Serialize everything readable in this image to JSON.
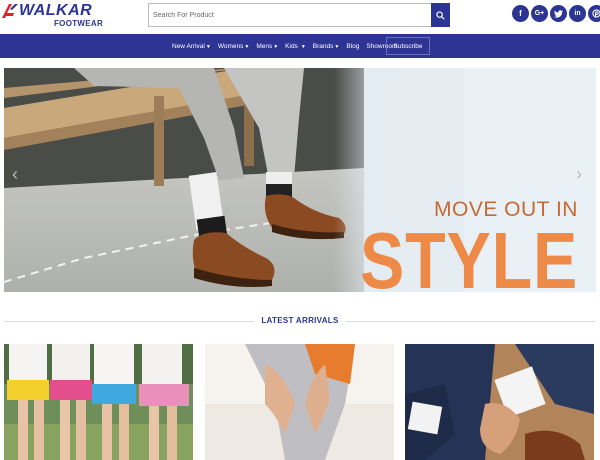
{
  "header": {
    "logo_text": "WALKAR",
    "logo_sub": "FOOTWEAR",
    "search_placeholder": "Search For Product",
    "search_icon": "search-icon",
    "brand_color": "#2c3593",
    "socials": [
      {
        "name": "facebook",
        "glyph": "f"
      },
      {
        "name": "google-plus",
        "glyph": "G+"
      },
      {
        "name": "twitter",
        "glyph": "t"
      },
      {
        "name": "linkedin",
        "glyph": "in"
      },
      {
        "name": "pinterest",
        "glyph": "p"
      }
    ]
  },
  "nav": {
    "items": [
      {
        "label": "New Arrival",
        "dropdown": true
      },
      {
        "label": "Womens",
        "dropdown": true
      },
      {
        "label": "Mens",
        "dropdown": true
      },
      {
        "label": "Kids",
        "dropdown": true
      },
      {
        "label": "Brands",
        "dropdown": true
      },
      {
        "label": "Blog",
        "dropdown": false
      },
      {
        "label": "Showroom",
        "dropdown": false
      }
    ],
    "subscribe_label": "Subscribe"
  },
  "banner": {
    "line1": "MOVE OUT IN",
    "line2": "STYLE",
    "prev_arrow": "‹",
    "next_arrow": "›"
  },
  "latest": {
    "title": "LATEST ARRIVALS"
  }
}
